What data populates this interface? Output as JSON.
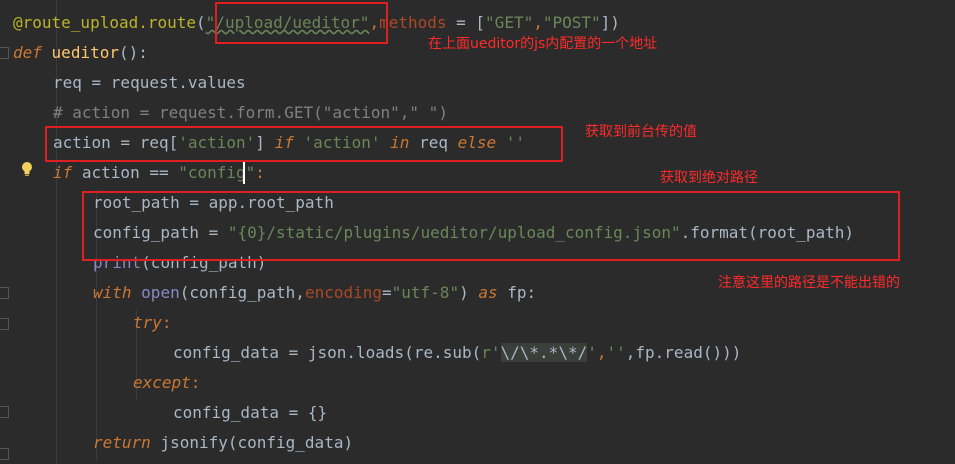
{
  "code": {
    "line1": {
      "t1": "@route_upload.route",
      "t2": "(",
      "t3": "\"/upload/ueditor\"",
      "t4": ",",
      "t5": "methods",
      "t6": " = [",
      "t7": "\"GET\"",
      "t8": ",",
      "t9": "\"POST\"",
      "t10": "])"
    },
    "line2": {
      "t1": "def",
      "t2": " ",
      "t3": "ueditor",
      "t4": "():"
    },
    "line3": {
      "t1": "req = request.values"
    },
    "line4": {
      "t1": "# action = request.form.GET(\"action\",\" \")"
    },
    "line5": {
      "t1": "action = req[",
      "t2": "'action'",
      "t3": "] ",
      "t4": "if",
      "t5": " ",
      "t6": "'action'",
      "t7": " ",
      "t8": "in",
      "t9": " req ",
      "t10": "else",
      "t11": " ",
      "t12": "''"
    },
    "line6": {
      "t1": "if",
      "t2": " action == ",
      "t3": "\"config\"",
      "t4": ":"
    },
    "line7": {
      "t1": "root_path = app.root_path"
    },
    "line8": {
      "t1": "config_path = ",
      "t2": "\"{0}/static/plugins/ueditor/upload_config.json\"",
      "t3": ".format(root_path)"
    },
    "line9": {
      "t1": "print",
      "t2": "(config_path)"
    },
    "line10": {
      "t1": "with",
      "t2": " ",
      "t3": "open",
      "t4": "(config_path,",
      "t5": "encoding",
      "t6": "=",
      "t7": "\"utf-8\"",
      "t8": ") ",
      "t9": "as",
      "t10": " fp:"
    },
    "line11": {
      "t1": "try",
      "t2": ":"
    },
    "line12": {
      "t1": "config_data = json.loads(re.sub(",
      "t2": "r'",
      "t3": "\\/\\*.*\\*/",
      "t4": "'",
      "t5": ",",
      "t6": "''",
      "t7": ",fp.read()))"
    },
    "line13": {
      "t1": "except",
      "t2": ":"
    },
    "line14": {
      "t1": "config_data = {}"
    },
    "line15": {
      "t1": "return",
      "t2": " jsonify(config_data)"
    }
  },
  "annotations": {
    "note1": "在上面ueditor的js内配置的一个地址",
    "note2": "获取到前台传的值",
    "note3": "获取到绝对路径",
    "note4": "注意这里的路径是不能出错的"
  },
  "icons": {
    "bulb": "lightbulb-icon",
    "fold": "fold-marker-icon"
  },
  "colors": {
    "background": "#2b2b2b",
    "default_text": "#a9b7c6",
    "keyword": "#cc7832",
    "string": "#6a8759",
    "function": "#ffc66d",
    "comment": "#808080",
    "decorator": "#bbb529",
    "builtin": "#8888c6",
    "annotation_red": "#e02020"
  }
}
